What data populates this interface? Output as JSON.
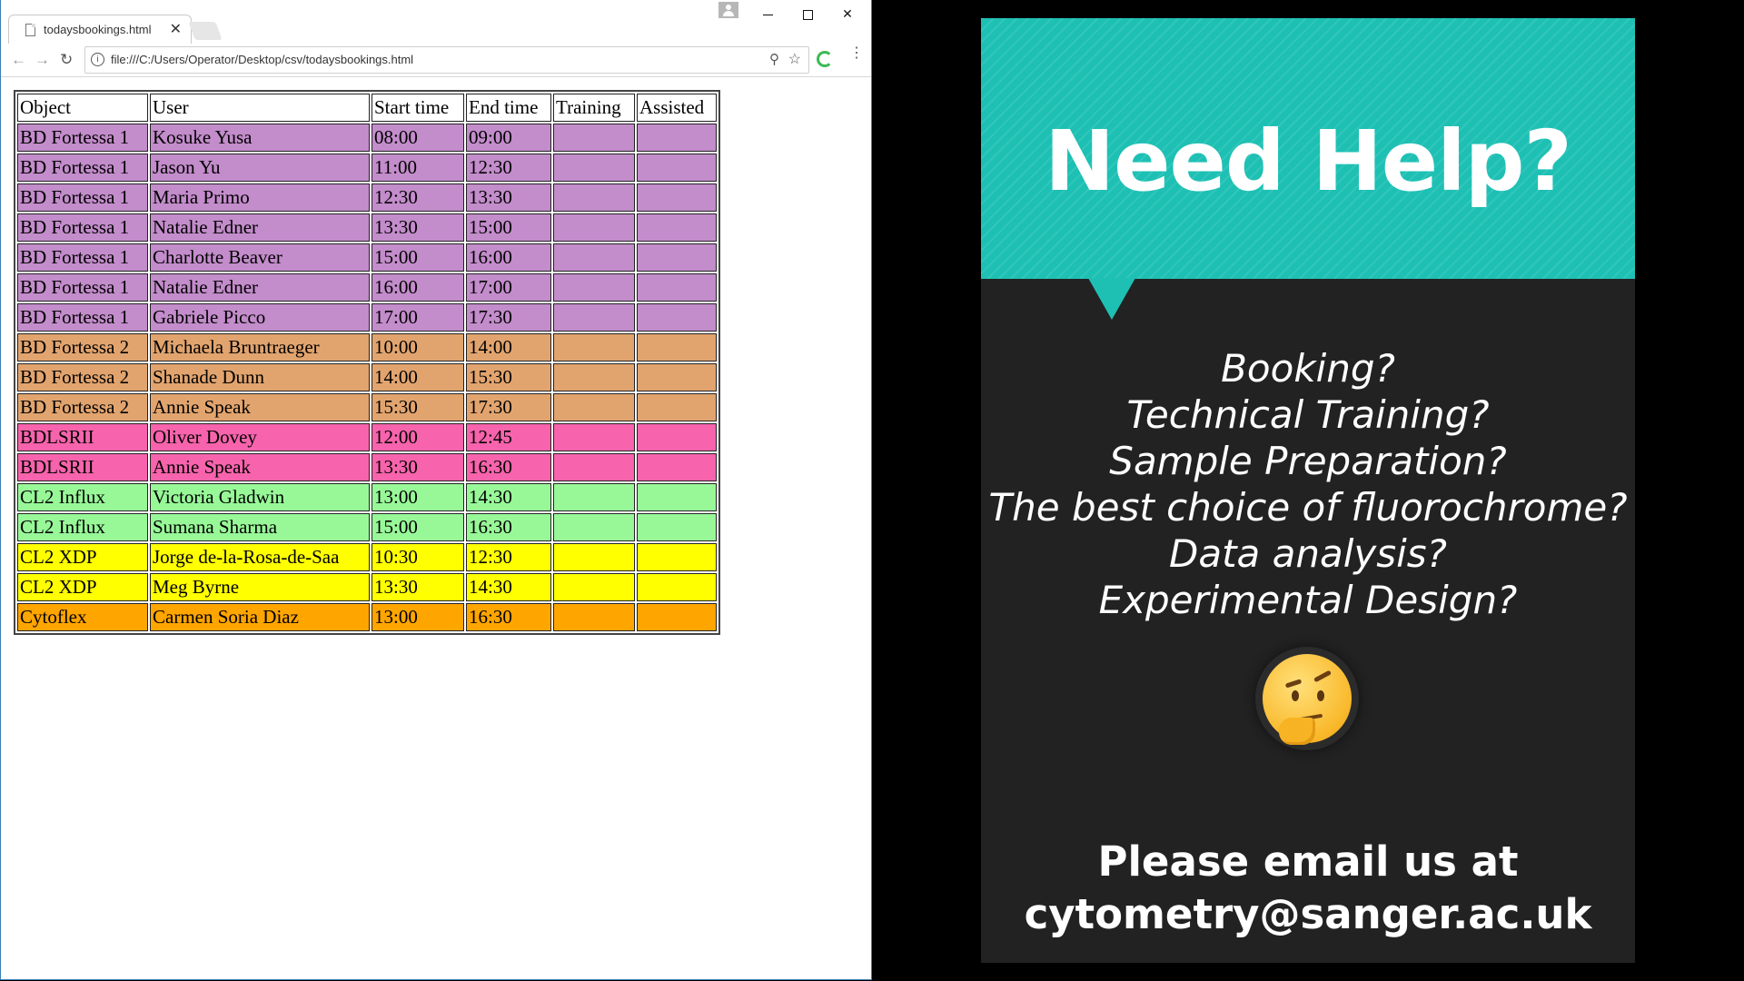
{
  "browser": {
    "tab_title": "todaysbookings.html",
    "tab_close": "✕",
    "url": "file:///C:/Users/Operator/Desktop/csv/todaysbookings.html",
    "window_controls": {
      "close": "✕"
    }
  },
  "table": {
    "headers": [
      "Object",
      "User",
      "Start time",
      "End time",
      "Training",
      "Assisted"
    ],
    "row_colors": {
      "BD Fortessa 1": "#c38ccb",
      "BD Fortessa 2": "#e2a46e",
      "BDLSRII": "#f763ac",
      "CL2 Influx": "#98f898",
      "CL2 XDP": "#ffff00",
      "Cytoflex": "#ffa500"
    },
    "rows": [
      {
        "object": "BD Fortessa 1",
        "user": "Kosuke Yusa",
        "start": "08:00",
        "end": "09:00",
        "color": "#c38ccb"
      },
      {
        "object": "BD Fortessa 1",
        "user": "Jason Yu",
        "start": "11:00",
        "end": "12:30",
        "color": "#c38ccb"
      },
      {
        "object": "BD Fortessa 1",
        "user": "Maria Primo",
        "start": "12:30",
        "end": "13:30",
        "color": "#c38ccb"
      },
      {
        "object": "BD Fortessa 1",
        "user": "Natalie Edner",
        "start": "13:30",
        "end": "15:00",
        "color": "#c38ccb"
      },
      {
        "object": "BD Fortessa 1",
        "user": "Charlotte Beaver",
        "start": "15:00",
        "end": "16:00",
        "color": "#c38ccb"
      },
      {
        "object": "BD Fortessa 1",
        "user": "Natalie Edner",
        "start": "16:00",
        "end": "17:00",
        "color": "#c38ccb"
      },
      {
        "object": "BD Fortessa 1",
        "user": "Gabriele Picco",
        "start": "17:00",
        "end": "17:30",
        "color": "#c38ccb"
      },
      {
        "object": "BD Fortessa 2",
        "user": "Michaela Bruntraeger",
        "start": "10:00",
        "end": "14:00",
        "color": "#e2a46e"
      },
      {
        "object": "BD Fortessa 2",
        "user": "Shanade Dunn",
        "start": "14:00",
        "end": "15:30",
        "color": "#e2a46e"
      },
      {
        "object": "BD Fortessa 2",
        "user": "Annie Speak",
        "start": "15:30",
        "end": "17:30",
        "color": "#e2a46e"
      },
      {
        "object": "BDLSRII",
        "user": "Oliver Dovey",
        "start": "12:00",
        "end": "12:45",
        "color": "#f763ac"
      },
      {
        "object": "BDLSRII",
        "user": "Annie Speak",
        "start": "13:30",
        "end": "16:30",
        "color": "#f763ac"
      },
      {
        "object": "CL2 Influx",
        "user": "Victoria Gladwin",
        "start": "13:00",
        "end": "14:30",
        "color": "#98f898"
      },
      {
        "object": "CL2 Influx",
        "user": "Sumana Sharma",
        "start": "15:00",
        "end": "16:30",
        "color": "#98f898"
      },
      {
        "object": "CL2 XDP",
        "user": "Jorge de-la-Rosa-de-Saa",
        "start": "10:30",
        "end": "12:30",
        "color": "#ffff00"
      },
      {
        "object": "CL2 XDP",
        "user": "Meg Byrne",
        "start": "13:30",
        "end": "14:30",
        "color": "#ffff00"
      },
      {
        "object": "Cytoflex",
        "user": "Carmen Soria Diaz",
        "start": "13:00",
        "end": "16:30",
        "color": "#ffa500"
      }
    ]
  },
  "poster": {
    "headline": "Need Help?",
    "questions": [
      "Booking?",
      "Technical Training?",
      "Sample Preparation?",
      "The best choice of fluorochrome?",
      "Data analysis?",
      "Experimental Design?"
    ],
    "emoji": "thinking-face-icon",
    "contact_line1": "Please email us at",
    "contact_line2": "cytometry@sanger.ac.uk",
    "banner_color": "#1ec0b4",
    "background_color": "#222222"
  }
}
